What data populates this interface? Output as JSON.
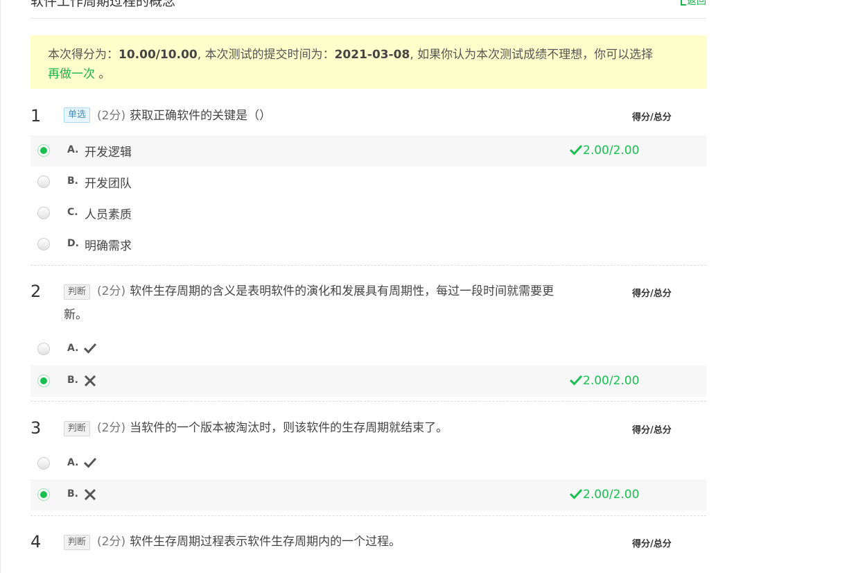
{
  "header": {
    "title": "软件工作周期过程的概念",
    "back_label": "返回"
  },
  "result": {
    "prefix": "本次得分为：",
    "score": "10.00/10.00",
    "mid": ", 本次测试的提交时间为：",
    "date": "2021-03-08",
    "suffix": ", 如果你认为本次测试成绩不理想，你可以选择",
    "redo_label": "再做一次",
    "end": " 。"
  },
  "colors": {
    "accent_green": "#17c04f",
    "notice_bg": "#ffffcc"
  },
  "questions": [
    {
      "number": "1",
      "type": "单选",
      "points": "(2分)",
      "text": "获取正确软件的关键是（）",
      "score_header": "得分/总分",
      "options": [
        {
          "letter": "A.",
          "text": "开发逻辑",
          "selected": true,
          "score": "2.00/2.00"
        },
        {
          "letter": "B.",
          "text": "开发团队",
          "selected": false
        },
        {
          "letter": "C.",
          "text": "人员素质",
          "selected": false
        },
        {
          "letter": "D.",
          "text": "明确需求",
          "selected": false
        }
      ]
    },
    {
      "number": "2",
      "type": "判断",
      "points": "(2分)",
      "text": "软件生存周期的含义是表明软件的演化和发展具有周期性，每过一段时间就需要更新。",
      "score_header": "得分/总分",
      "options": [
        {
          "letter": "A.",
          "icon": "check-icon",
          "selected": false
        },
        {
          "letter": "B.",
          "icon": "cross-icon",
          "selected": true,
          "score": "2.00/2.00"
        }
      ]
    },
    {
      "number": "3",
      "type": "判断",
      "points": "(2分)",
      "text": "当软件的一个版本被淘汰时，则该软件的生存周期就结束了。",
      "score_header": "得分/总分",
      "options": [
        {
          "letter": "A.",
          "icon": "check-icon",
          "selected": false
        },
        {
          "letter": "B.",
          "icon": "cross-icon",
          "selected": true,
          "score": "2.00/2.00"
        }
      ]
    },
    {
      "number": "4",
      "type": "判断",
      "points": "(2分)",
      "text": "软件生存周期过程表示软件生存周期内的一个过程。",
      "score_header": "得分/总分"
    }
  ]
}
